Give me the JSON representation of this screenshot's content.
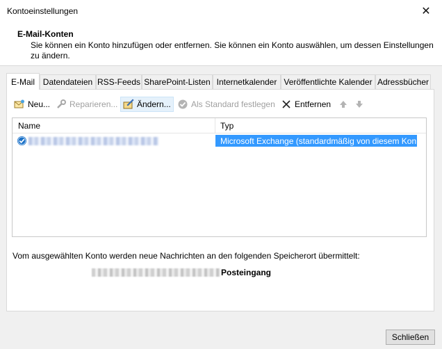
{
  "window": {
    "title": "Kontoeinstellungen",
    "close_glyph": "✕"
  },
  "header": {
    "title": "E-Mail-Konten",
    "description": "Sie können ein Konto hinzufügen oder entfernen. Sie können ein Konto auswählen, um dessen Einstellungen zu ändern."
  },
  "tabs": [
    {
      "label": "E-Mail",
      "active": true
    },
    {
      "label": "Datendateien",
      "active": false
    },
    {
      "label": "RSS-Feeds",
      "active": false
    },
    {
      "label": "SharePoint-Listen",
      "active": false
    },
    {
      "label": "Internetkalender",
      "active": false
    },
    {
      "label": "Veröffentlichte Kalender",
      "active": false
    },
    {
      "label": "Adressbücher",
      "active": false
    }
  ],
  "toolbar": {
    "new_label": "Neu...",
    "repair_label": "Reparieren...",
    "change_label": "Ändern...",
    "set_default_label": "Als Standard festlegen",
    "remove_label": "Entfernen",
    "move_up_icon": "arrow-up-icon",
    "move_down_icon": "arrow-down-icon"
  },
  "accounts_list": {
    "columns": [
      "Name",
      "Typ"
    ],
    "rows": [
      {
        "name": "",
        "type": "Microsoft Exchange (standardmäßig von diesem Kon...",
        "selected": true,
        "default_icon": "check-circle-icon"
      }
    ]
  },
  "delivery": {
    "info": "Vom ausgewählten Konto werden neue Nachrichten an den folgenden Speicherort übermittelt:",
    "folder": "Posteingang"
  },
  "footer": {
    "close_label": "Schließen"
  },
  "colors": {
    "selection": "#3399ff",
    "accent": "#1e73c8"
  }
}
